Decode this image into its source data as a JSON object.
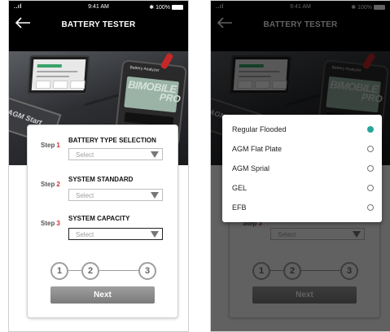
{
  "status": {
    "signal": "..ıl",
    "time": "9:41 AM",
    "battery": "100%"
  },
  "app_title": "BATTERY TESTER",
  "hero": {
    "battery_label": "AGM Start",
    "device_brand_small": "Battery Analyzer",
    "device_brand_main": "BIMOBILE",
    "device_brand_sub": "PRO"
  },
  "steps": [
    {
      "word": "Step",
      "num": "1",
      "title": "BATTERY TYPE SELECTION",
      "placeholder": "Select"
    },
    {
      "word": "Step",
      "num": "2",
      "title": "SYSTEM STANDARD",
      "placeholder": "Select"
    },
    {
      "word": "Step",
      "num": "3",
      "title": "SYSTEM CAPACITY",
      "placeholder": "Select"
    }
  ],
  "stepper": [
    "1",
    "2",
    "3"
  ],
  "next_label": "Next",
  "dropdown": {
    "options": [
      {
        "label": "Regular Flooded",
        "selected": true
      },
      {
        "label": "AGM Flat Plate",
        "selected": false
      },
      {
        "label": "AGM Sprial",
        "selected": false
      },
      {
        "label": "GEL",
        "selected": false
      },
      {
        "label": "EFB",
        "selected": false
      }
    ]
  },
  "colors": {
    "accent": "#26a69a",
    "step_number": "#d32f2f",
    "header_bg": "#000000"
  }
}
